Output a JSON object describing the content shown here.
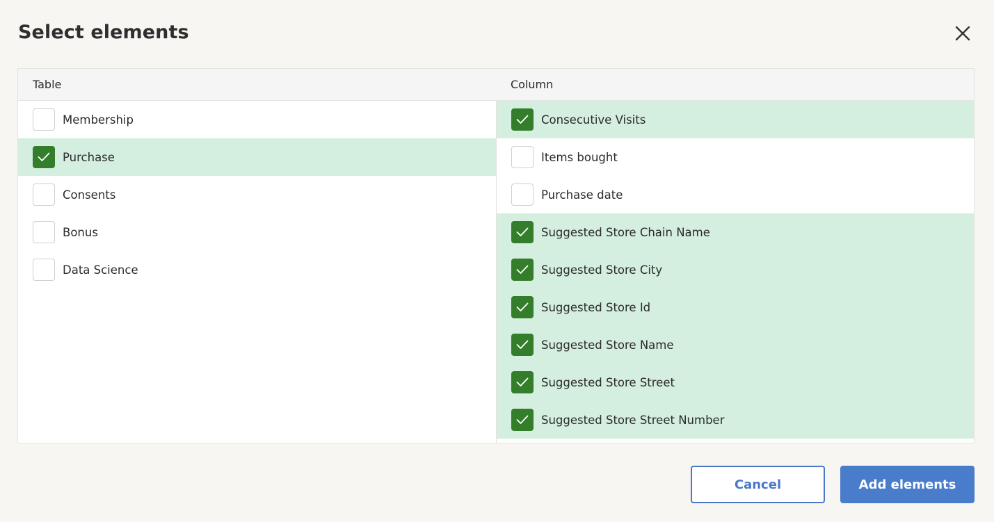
{
  "dialog": {
    "title": "Select elements",
    "close_icon": "close-icon"
  },
  "table_panel": {
    "header": "Table",
    "items": [
      {
        "label": "Membership",
        "checked": false
      },
      {
        "label": "Purchase",
        "checked": true
      },
      {
        "label": "Consents",
        "checked": false
      },
      {
        "label": "Bonus",
        "checked": false
      },
      {
        "label": "Data Science",
        "checked": false
      }
    ]
  },
  "column_panel": {
    "header": "Column",
    "items": [
      {
        "label": "Consecutive Visits",
        "checked": true
      },
      {
        "label": "Items bought",
        "checked": false
      },
      {
        "label": "Purchase date",
        "checked": false
      },
      {
        "label": "Suggested Store Chain Name",
        "checked": true
      },
      {
        "label": "Suggested Store City",
        "checked": true
      },
      {
        "label": "Suggested Store Id",
        "checked": true
      },
      {
        "label": "Suggested Store Name",
        "checked": true
      },
      {
        "label": "Suggested Store Street",
        "checked": true
      },
      {
        "label": "Suggested Store Street Number",
        "checked": true
      }
    ]
  },
  "footer": {
    "cancel_label": "Cancel",
    "add_label": "Add elements"
  },
  "colors": {
    "selected_row": "#d4eedf",
    "checkbox_checked": "#347e2b",
    "accent": "#4a7ccc"
  }
}
